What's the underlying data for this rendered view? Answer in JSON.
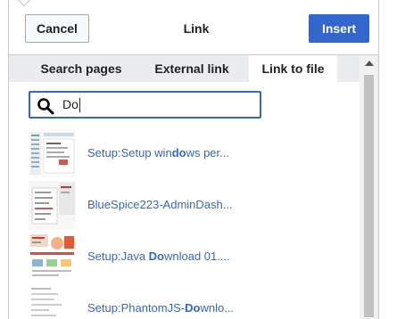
{
  "header": {
    "cancel_label": "Cancel",
    "title": "Link",
    "insert_label": "Insert"
  },
  "tabs": [
    {
      "label": "Search pages",
      "active": false
    },
    {
      "label": "External link",
      "active": false
    },
    {
      "label": "Link to file",
      "active": true
    }
  ],
  "search": {
    "value": "Do"
  },
  "results": [
    {
      "prefix": "Setup:Setup win",
      "match": "do",
      "suffix": "ws per..."
    },
    {
      "prefix": "BlueSpice223-AdminDash...",
      "match": "",
      "suffix": ""
    },
    {
      "prefix": "Setup:Java ",
      "match": "Do",
      "suffix": "wnload 01...."
    },
    {
      "prefix": "Setup:PhantomJS-",
      "match": "Do",
      "suffix": "wnlo..."
    }
  ],
  "colors": {
    "accent": "#3366cc",
    "panel_bg": "#eaecf0",
    "text": "#202122"
  }
}
